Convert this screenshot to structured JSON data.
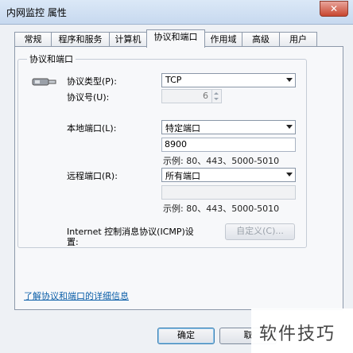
{
  "window": {
    "title": "内网监控 属性"
  },
  "tabs": [
    {
      "label": "常规"
    },
    {
      "label": "程序和服务"
    },
    {
      "label": "计算机"
    },
    {
      "label": "协议和端口"
    },
    {
      "label": "作用域"
    },
    {
      "label": "高级"
    },
    {
      "label": "用户"
    }
  ],
  "active_tab": "协议和端口",
  "group": {
    "title": "协议和端口"
  },
  "protocol": {
    "type_label": "协议类型(P):",
    "type_value": "TCP",
    "number_label": "协议号(U):",
    "number_value": "6"
  },
  "local_port": {
    "label": "本地端口(L):",
    "selected": "特定端口",
    "value": "8900",
    "example": "示例: 80、443、5000-5010"
  },
  "remote_port": {
    "label": "远程端口(R):",
    "selected": "所有端口",
    "value": "",
    "example": "示例: 80、443、5000-5010"
  },
  "icmp": {
    "label_line1": "Internet 控制消息协议(ICMP)设",
    "label_line2": "置:",
    "button_label": "自定义(C)..."
  },
  "link_text": "了解协议和端口的详细信息",
  "buttons": {
    "ok": "确定",
    "cancel": "取"
  },
  "watermark": "软件技巧"
}
